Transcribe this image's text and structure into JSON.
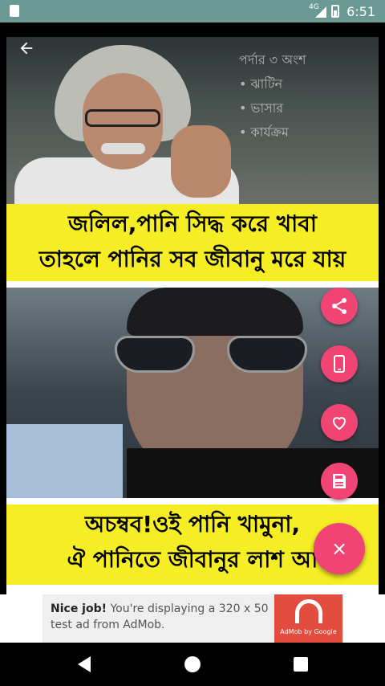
{
  "status_bar": {
    "time": "6:51",
    "network": "4G"
  },
  "meme": {
    "caption_top_line1": "জলিল,পানি সিদ্ধ করে খাবা",
    "caption_top_line2": "তাহলে পানির সব জীবানু মরে যায়",
    "board_text": [
      "পর্দার ৩ অংশ",
      "• ঝাটিন",
      "• ভাসার",
      "• কার্যক্রম"
    ],
    "caption_bottom_line1": "অচম্বব!ওই পানি খামুনা,",
    "caption_bottom_line2": "ঐ পানিতে জীবানুর লাশ আ"
  },
  "actions": {
    "share_icon": "share-icon",
    "wallpaper_icon": "phone-icon",
    "favorite_icon": "heart-icon",
    "save_icon": "save-icon",
    "close_icon": "close-icon",
    "close_label": "×"
  },
  "ad": {
    "headline": "Nice job!",
    "body": "You're displaying a 320 x 50 test ad from AdMob.",
    "logo_caption": "AdMob by Google"
  },
  "colors": {
    "accent": "#ef4474",
    "caption_bg": "#f6ee24",
    "status_bar": "#6a9a93"
  }
}
